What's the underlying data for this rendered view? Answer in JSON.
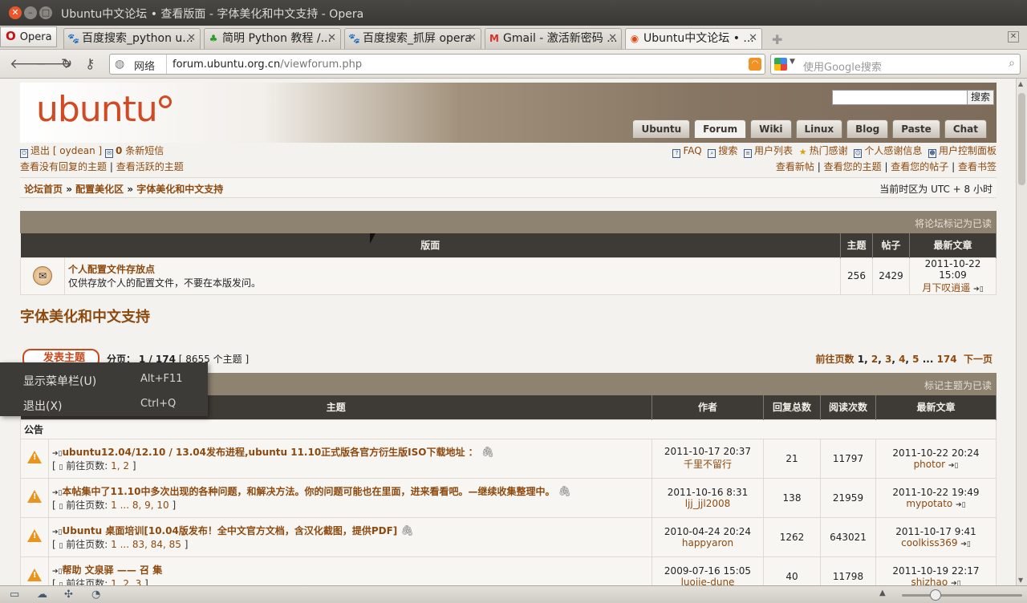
{
  "window": {
    "title": "Ubuntu中文论坛 • 查看版面 - 字体美化和中文支持 - Opera"
  },
  "opera_button": "Opera",
  "tabs": [
    {
      "label": "百度搜索_python u..."
    },
    {
      "label": "简明 Python 教程 /..."
    },
    {
      "label": "百度搜索_抓屏 opera"
    },
    {
      "label": "Gmail - 激活新密码 ..."
    },
    {
      "label": "Ubuntu中文论坛 • ..."
    }
  ],
  "address": {
    "network_label": "网络",
    "url_host": "forum.ubuntu.org.cn",
    "url_path": "/viewforum.php"
  },
  "search": {
    "placeholder": "使用Google搜索"
  },
  "site": {
    "logo": "ubuntu",
    "search_button": "搜索",
    "nav_tabs": [
      "Ubuntu",
      "Forum",
      "Wiki",
      "Linux",
      "Blog",
      "Paste",
      "Chat"
    ]
  },
  "userbar": {
    "logout": "退出 [ oydean ]",
    "pm_count": "0",
    "pm_label": " 条新短信",
    "links": [
      "FAQ",
      "搜索",
      "用户列表",
      "热门感谢",
      "个人感谢信息",
      "用户控制面板"
    ],
    "unanswered": "查看没有回复的主题",
    "active": "查看活跃的主题",
    "new_posts": "查看新帖",
    "your_topics": "查看您的主题",
    "your_posts": "查看您的帖子",
    "bookmarks": "查看书签"
  },
  "breadcrumb": {
    "home": "论坛首页",
    "section": "配置美化区",
    "forum": "字体美化和中文支持",
    "timezone": "当前时区为 UTC + 8 小时"
  },
  "subforum": {
    "mark_read": "将论坛标记为已读",
    "headers": [
      "版面",
      "主题",
      "帖子",
      "最新文章"
    ],
    "row": {
      "name": "个人配置文件存放点",
      "desc": "仅供存放个人的配置文件，不要在本版发问。",
      "topics": "256",
      "posts": "2429",
      "last_time": "2011-10-22 15:09",
      "last_user": "月下叹逍遥"
    }
  },
  "forum": {
    "title": "字体美化和中文支持",
    "post_button": "发表主题",
    "page_info_label": "分页：",
    "page_info_value": "1 / 174",
    "topic_count": " [ 8655 个主题 ]",
    "goto_label": "前往页数",
    "pages": [
      "1",
      "2",
      "3",
      "4",
      "5",
      "174"
    ],
    "next": "下一页",
    "mark_topics_read": "标记主题为已读",
    "headers": [
      "主题",
      "作者",
      "回复总数",
      "阅读次数",
      "最新文章"
    ],
    "section_label": "公告"
  },
  "topics": [
    {
      "title": "ubuntu12.04/12.10 / 13.04发布进程,ubuntu 11.10正式版各官方衍生版ISO下载地址 ：",
      "pages_label": "前往页数:",
      "pages": "1, 2",
      "author_time": "2011-10-17 20:37",
      "author": "千里不留行",
      "replies": "21",
      "views": "11797",
      "last_time": "2011-10-22 20:24",
      "last_user": "photor"
    },
    {
      "title": "本帖集中了11.10中多次出现的各种问题，和解决方法。你的问题可能也在里面，进来看看吧。—继续收集整理中。",
      "pages_label": "前往页数:",
      "pages": "1 ... 8, 9, 10",
      "author_time": "2011-10-16 8:31",
      "author": "ljj_jjl2008",
      "replies": "138",
      "views": "21959",
      "last_time": "2011-10-22 19:49",
      "last_user": "mypotato"
    },
    {
      "title": "Ubuntu 桌面培训[10.04版发布！全中文官方文档，含汉化截图，提供PDF]",
      "pages_label": "前往页数:",
      "pages": "1 ... 83, 84, 85",
      "author_time": "2010-04-24 20:24",
      "author": "happyaron",
      "replies": "1262",
      "views": "643021",
      "last_time": "2011-10-17 9:41",
      "last_user": "coolkiss369"
    },
    {
      "title": "帮助 文泉驿 —— 召 集",
      "pages_label": "前往页数:",
      "pages": "1, 2, 3",
      "author_time": "2009-07-16 15:05",
      "author": "luojie-dune",
      "replies": "40",
      "views": "11798",
      "last_time": "2011-10-19 22:17",
      "last_user": "shizhao"
    }
  ],
  "context_menu": [
    {
      "label": "显示菜单栏(U)",
      "shortcut": "Alt+F11"
    },
    {
      "label": "退出(X)",
      "shortcut": "Ctrl+Q"
    }
  ]
}
